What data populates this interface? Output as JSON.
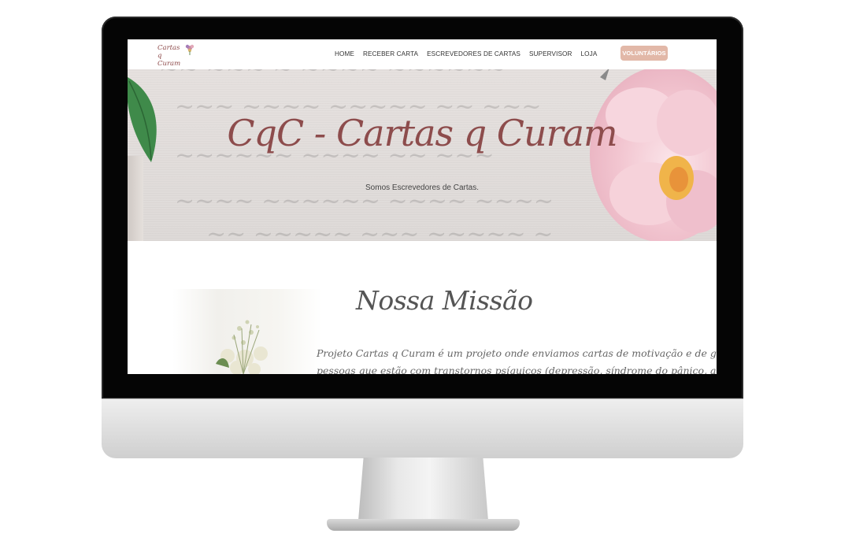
{
  "site": {
    "logo_line1": "Cartas",
    "logo_line2": "q Curam"
  },
  "nav": {
    "items": [
      {
        "label": "HOME"
      },
      {
        "label": "RECEBER CARTA"
      },
      {
        "label": "ESCREVEDORES DE CARTAS"
      },
      {
        "label": "SUPERVISOR"
      },
      {
        "label": "LOJA"
      }
    ],
    "cta_label": "VOLUNTÁRIOS"
  },
  "hero": {
    "title": "CqC - Cartas q Curam",
    "subtitle": "Somos Escrevedores de Cartas."
  },
  "mission": {
    "title": "Nossa Missão",
    "line1": "Projeto Cartas q Curam é um projeto onde enviamos cartas de motivação e de gratidão, para as",
    "line2": "pessoas que estão com transtornos psíquicos (depressão, síndrome do pânico, ansiedade, etc.) como"
  },
  "colors": {
    "accent": "#8d4c4c",
    "cta": "#e2b8a8"
  }
}
